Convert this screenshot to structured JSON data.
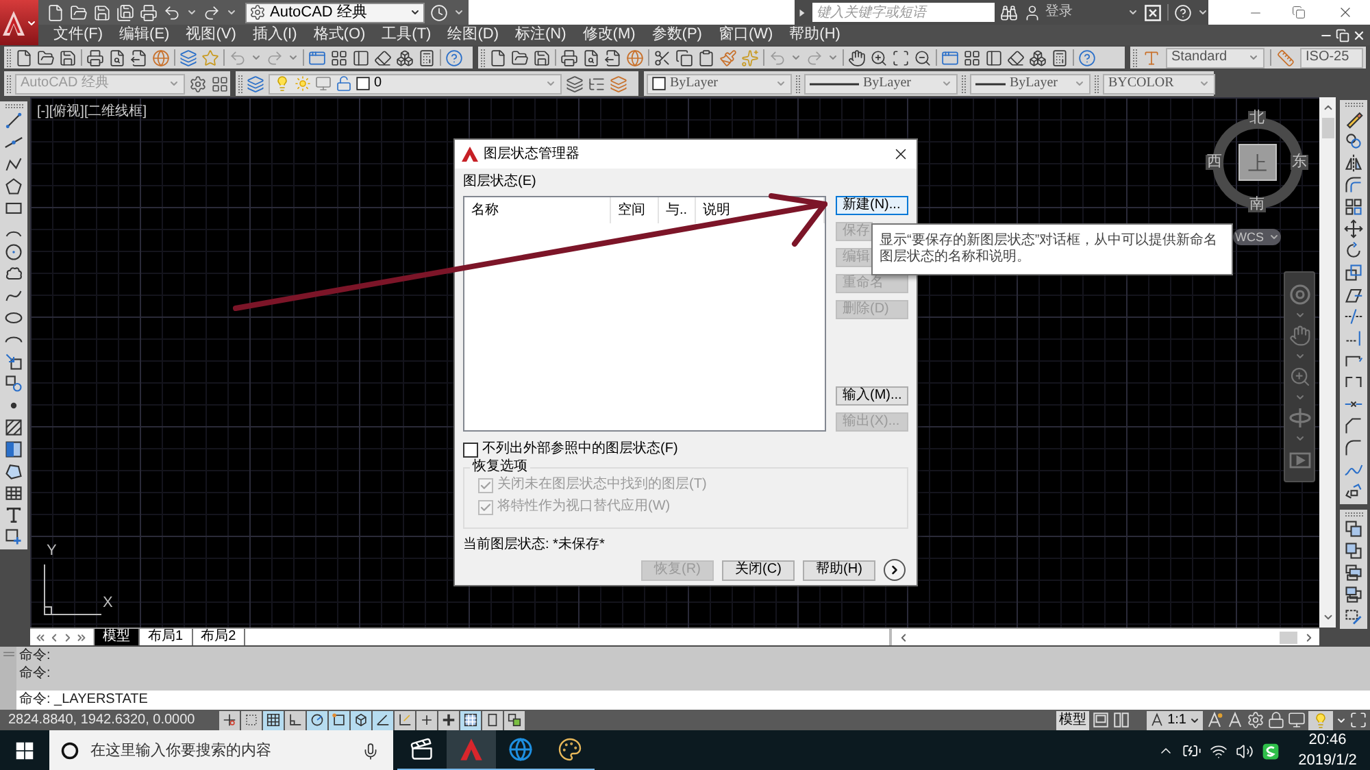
{
  "title_bar": {
    "workspace": "AutoCAD 经典",
    "search": {
      "placeholder": "键入关键字或短语"
    },
    "sign_in": "登录"
  },
  "menu_bar": [
    "文件(F)",
    "编辑(E)",
    "视图(V)",
    "插入(I)",
    "格式(O)",
    "工具(T)",
    "绘图(D)",
    "标注(N)",
    "修改(M)",
    "参数(P)",
    "窗口(W)",
    "帮助(H)"
  ],
  "styles_toolbar": {
    "text_style": "Standard",
    "dim_style": "ISO-25"
  },
  "workspace_toolbar": {
    "value": "AutoCAD 经典",
    "disabled": true
  },
  "layer_toolbar": {
    "layer": "0",
    "on": true,
    "frozen": false,
    "locked": false
  },
  "properties_toolbar": {
    "color_setting": "ByLayer",
    "linetype": "ByLayer",
    "lineweight": "ByLayer",
    "plot_style": "BYCOLOR"
  },
  "viewport": {
    "label": "[-][俯视][二维线框]",
    "viewcube": {
      "north": "北",
      "west": "西",
      "top": "上",
      "east": "东",
      "south": "南",
      "ucs_menu": "WCS"
    },
    "ucs_icon": {
      "y": "Y",
      "x": "X"
    }
  },
  "dialog": {
    "title": "图层状态管理器",
    "list_label": "图层状态(E)",
    "columns": [
      "名称",
      "空间",
      "与..",
      "说明"
    ],
    "state_buttons": [
      {
        "label": "新建(N)...",
        "disabled": false,
        "focused": true
      },
      {
        "label": "保存",
        "disabled": true,
        "focused": false
      },
      {
        "label": "编辑",
        "disabled": true,
        "focused": false
      },
      {
        "label": "重命名",
        "disabled": true,
        "focused": false
      },
      {
        "label": "删除(D)",
        "disabled": true,
        "focused": false
      }
    ],
    "file_buttons": [
      {
        "label": "输入(M)...",
        "disabled": false
      },
      {
        "label": "输出(X)...",
        "disabled": true
      }
    ],
    "exclude_xref": {
      "label": "不列出外部参照中的图层状态(F)",
      "checked": false
    },
    "restore_options": {
      "title": "恢复选项",
      "options": [
        {
          "label": "关闭未在图层状态中找到的图层(T)",
          "checked": true,
          "disabled": true
        },
        {
          "label": "将特性作为视口替代应用(W)",
          "checked": true,
          "disabled": true
        }
      ]
    },
    "current_state": "当前图层状态: *未保存*",
    "footer_buttons": [
      {
        "label": "恢复(R)",
        "disabled": true
      },
      {
        "label": "关闭(C)",
        "disabled": false
      },
      {
        "label": "帮助(H)",
        "disabled": false
      }
    ]
  },
  "tooltip": "显示“要保存的新图层状态”对话框，从中可以提供新命名图层状态的名称和说明。",
  "layout_tabs": [
    {
      "label": "模型",
      "selected": true
    },
    {
      "label": "布局1",
      "selected": false
    },
    {
      "label": "布局2",
      "selected": false
    }
  ],
  "command_window": {
    "history": [
      "命令:",
      "命令:"
    ],
    "input": "命令: _LAYERSTATE"
  },
  "status_bar": {
    "coordinates": "2824.8840, 1942.6320, 0.0000",
    "toggles": [
      {
        "on": false
      },
      {
        "on": false
      },
      {
        "on": true
      },
      {
        "on": false
      },
      {
        "on": true
      },
      {
        "on": true
      },
      {
        "on": true
      },
      {
        "on": true
      },
      {
        "on": false
      },
      {
        "on": false
      },
      {
        "on": false
      },
      {
        "on": true
      },
      {
        "on": false
      },
      {
        "on": false
      }
    ],
    "model_button": "模型",
    "annotation_scale": "1:1"
  },
  "taskbar": {
    "search": {
      "placeholder": "在这里输入你要搜索的内容"
    },
    "apps": [
      {
        "running": true,
        "selected": false
      },
      {
        "running": true,
        "selected": true
      },
      {
        "running": true,
        "selected": false
      },
      {
        "running": true,
        "selected": false
      }
    ],
    "time": "20:46",
    "date": "2019/1/2"
  }
}
